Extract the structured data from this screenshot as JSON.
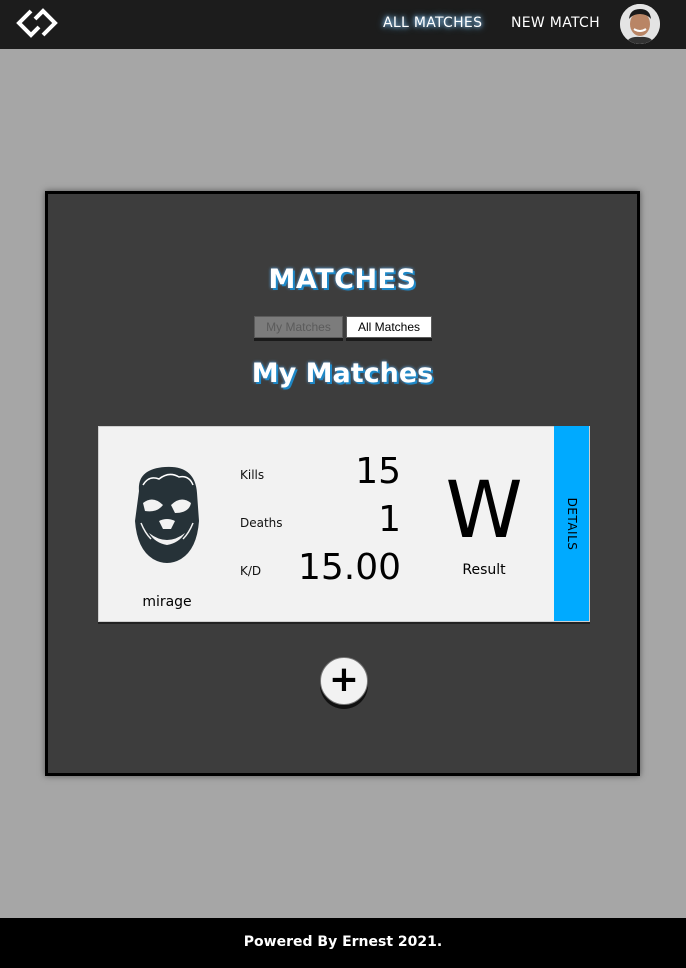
{
  "nav": {
    "all_matches": "ALL MATCHES",
    "new_match": "NEW MATCH"
  },
  "main": {
    "title": "MATCHES",
    "toggle_my": "My Matches",
    "toggle_all": "All Matches",
    "subtitle": "My Matches"
  },
  "match": {
    "map": "mirage",
    "kills_label": "Kills",
    "kills": "15",
    "deaths_label": "Deaths",
    "deaths": "1",
    "kd_label": "K/D",
    "kd": "15.00",
    "result": "W",
    "result_label": "Result",
    "details": "DETAILS"
  },
  "add_button_glyph": "+",
  "footer": "Powered By Ernest 2021.",
  "colors": {
    "accent": "#00aaff",
    "page_bg": "#a6a6a6",
    "panel_bg": "#3d3d3d"
  }
}
